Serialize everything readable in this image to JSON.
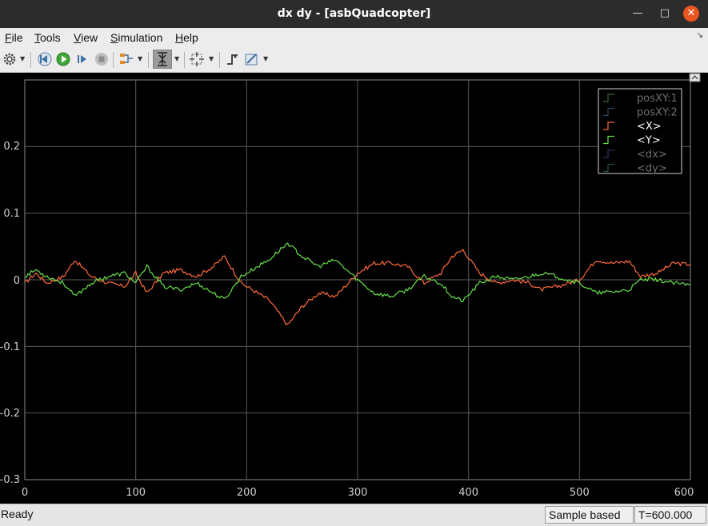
{
  "window": {
    "title": "dx dy - [asbQuadcopter]"
  },
  "menu": {
    "items": [
      {
        "label": "File",
        "key": "F"
      },
      {
        "label": "Tools",
        "key": "T"
      },
      {
        "label": "View",
        "key": "V"
      },
      {
        "label": "Simulation",
        "key": "S"
      },
      {
        "label": "Help",
        "key": "H"
      }
    ]
  },
  "toolbar": {
    "icons": [
      "gear-icon",
      "step-back-icon",
      "run-icon",
      "step-forward-icon",
      "stop-icon",
      "signal-selector-icon",
      "zoom-icon",
      "fit-to-view-icon",
      "triggers-icon",
      "cursor-measure-icon"
    ]
  },
  "colors": {
    "plot_background": "#000000",
    "grid": "#5a5a5a",
    "x_series": "#ff6a3d",
    "y_series": "#66e04a",
    "accent_close": "#e95420"
  },
  "chart_data": {
    "type": "line",
    "xlim": [
      0,
      600
    ],
    "ylim": [
      -0.3,
      0.3
    ],
    "x_ticks": [
      "0",
      "100",
      "200",
      "300",
      "400",
      "500",
      "600"
    ],
    "y_ticks": [
      "0.2",
      "0.1",
      "0",
      "-0.1",
      "-0.2",
      "-0.3"
    ],
    "grid": true,
    "legend_position": "top-right",
    "legend": [
      {
        "name": "posXY:1",
        "color": "#5fbf5f",
        "active": false
      },
      {
        "name": "posXY:2",
        "color": "#4a7fb0",
        "active": false
      },
      {
        "name": "<X>",
        "color": "#ff6a3d",
        "active": true
      },
      {
        "name": "<Y>",
        "color": "#66e04a",
        "active": true
      },
      {
        "name": "<dx>",
        "color": "#6a50b0",
        "active": false
      },
      {
        "name": "<dy>",
        "color": "#3f8f8f",
        "active": false
      }
    ],
    "series": [
      {
        "name": "<X>",
        "x": [
          0,
          10,
          20,
          35,
          45,
          60,
          75,
          90,
          100,
          110,
          125,
          140,
          155,
          170,
          180,
          195,
          210,
          220,
          237,
          250,
          265,
          280,
          300,
          315,
          330,
          345,
          360,
          375,
          385,
          395,
          410,
          425,
          440,
          455,
          465,
          480,
          500,
          515,
          530,
          545,
          555,
          570,
          585,
          600
        ],
        "y": [
          -0.005,
          0.01,
          -0.005,
          0.005,
          0.03,
          0.005,
          -0.005,
          -0.01,
          0.01,
          -0.02,
          0.01,
          0.015,
          0.005,
          0.02,
          0.035,
          -0.005,
          -0.02,
          -0.03,
          -0.068,
          -0.04,
          -0.02,
          -0.025,
          0.01,
          0.025,
          0.025,
          0.02,
          -0.005,
          0.01,
          0.035,
          0.045,
          0.01,
          -0.005,
          0.0,
          -0.005,
          -0.015,
          -0.01,
          0.0,
          0.03,
          0.025,
          0.028,
          0.005,
          0.01,
          0.025,
          0.023
        ]
      },
      {
        "name": "<Y>",
        "x": [
          0,
          10,
          20,
          35,
          45,
          60,
          75,
          90,
          100,
          110,
          125,
          140,
          155,
          170,
          180,
          195,
          210,
          220,
          237,
          250,
          265,
          280,
          300,
          315,
          330,
          345,
          360,
          375,
          385,
          395,
          410,
          425,
          440,
          455,
          465,
          480,
          500,
          515,
          530,
          545,
          555,
          570,
          585,
          600
        ],
        "y": [
          0.005,
          0.015,
          0.005,
          -0.005,
          -0.025,
          -0.005,
          0.005,
          0.01,
          -0.005,
          0.02,
          -0.01,
          -0.015,
          -0.005,
          -0.02,
          -0.03,
          0.005,
          0.02,
          0.03,
          0.055,
          0.035,
          0.02,
          0.03,
          0.0,
          -0.02,
          -0.025,
          -0.015,
          0.005,
          -0.005,
          -0.025,
          -0.032,
          -0.005,
          0.005,
          0.0,
          0.005,
          0.01,
          0.005,
          -0.005,
          -0.02,
          -0.018,
          -0.015,
          0.0,
          0.0,
          -0.005,
          -0.008
        ]
      }
    ]
  },
  "status": {
    "left": "Ready",
    "mode": "Sample based",
    "time": "T=600.000"
  }
}
